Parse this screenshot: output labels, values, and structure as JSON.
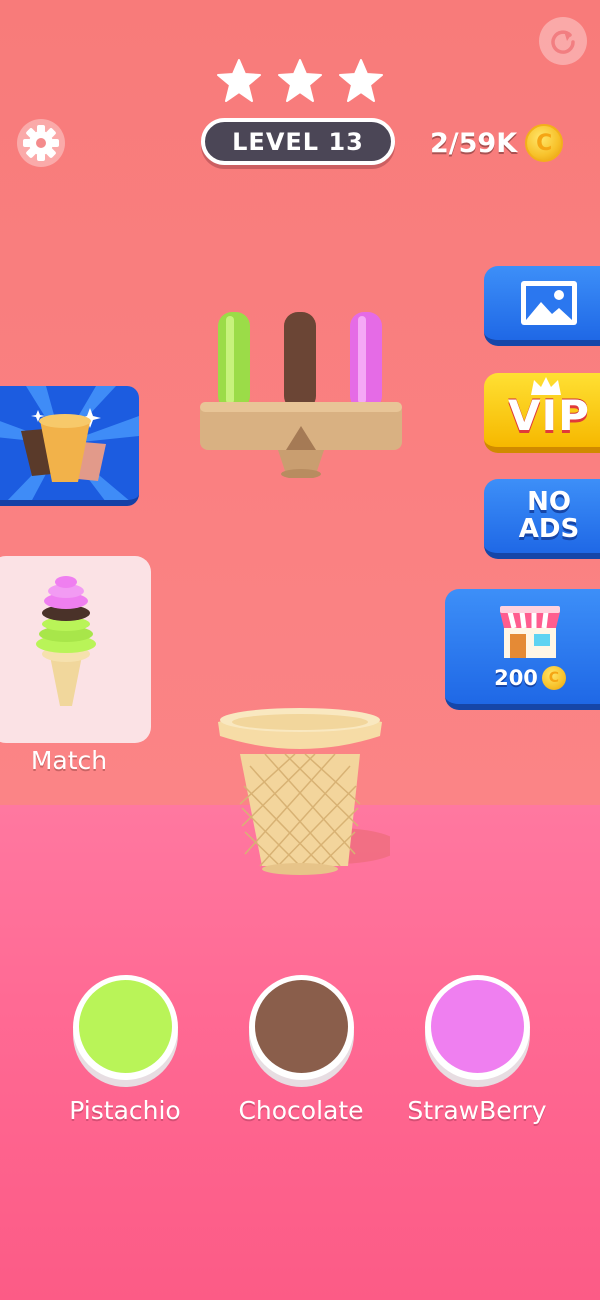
{
  "hud": {
    "level_label": "LEVEL 13",
    "coins_text": "2/59K",
    "coin_symbol": "C",
    "stars_count": 3
  },
  "side_buttons": {
    "vip_label": "VIP",
    "no_ads_line1": "NO",
    "no_ads_line2": "ADS",
    "shop_price": "200"
  },
  "match": {
    "label": "Match"
  },
  "flavors": [
    {
      "label": "Pistachio",
      "color": "#b9f458"
    },
    {
      "label": "Chocolate",
      "color": "#8a5e4b"
    },
    {
      "label": "StrawBerry",
      "color": "#ef7ff0"
    }
  ],
  "colors": {
    "background": "#f87b7a",
    "floor": "#ff6a94",
    "accent_blue": "#2b77ef",
    "vip_yellow": "#ffd21f",
    "level_pill": "#4b4656"
  }
}
